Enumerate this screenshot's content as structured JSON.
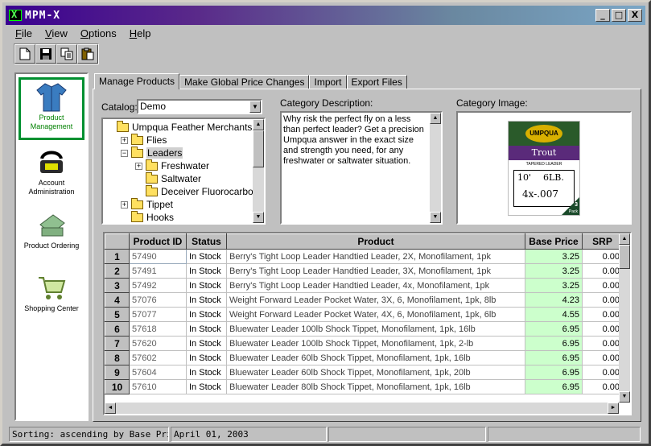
{
  "window": {
    "title": "MPM-X",
    "min_label": "_",
    "max_label": "□",
    "close_label": "X"
  },
  "menu": [
    "File",
    "View",
    "Options",
    "Help"
  ],
  "toolbar": {
    "buttons": [
      "new-icon",
      "save-icon",
      "copy-icon",
      "paste-icon"
    ]
  },
  "sidebar": {
    "items": [
      {
        "label": "Product Management",
        "icon": "jacket-icon"
      },
      {
        "label": "Account Administration",
        "icon": "phone-icon"
      },
      {
        "label": "Product Ordering",
        "icon": "register-icon"
      },
      {
        "label": "Shopping Center",
        "icon": "cart-icon"
      }
    ]
  },
  "tabs": [
    "Manage Products",
    "Make Global Price Changes",
    "Import",
    "Export Files"
  ],
  "catalog": {
    "label": "Catalog:",
    "value": "Demo"
  },
  "tree": {
    "items": [
      {
        "label": "Umpqua Feather Merchants",
        "level": 0,
        "expander": ""
      },
      {
        "label": "Flies",
        "level": 1,
        "expander": "+"
      },
      {
        "label": "Leaders",
        "level": 1,
        "expander": "−"
      },
      {
        "label": "Freshwater",
        "level": 2,
        "expander": "+"
      },
      {
        "label": "Saltwater",
        "level": 2,
        "expander": ""
      },
      {
        "label": "Deceiver Fluorocarbon",
        "level": 2,
        "expander": ""
      },
      {
        "label": "Tippet",
        "level": 1,
        "expander": "+"
      },
      {
        "label": "Hooks",
        "level": 1,
        "expander": ""
      }
    ]
  },
  "category_description": {
    "label": "Category Description:",
    "text": "Why risk the perfect fly on a less than perfect leader? Get a precision Umpqua answer in the exact size and strength you need, for any freshwater or saltwater situation."
  },
  "category_image": {
    "label": "Category Image:",
    "brand": "UMPQUA",
    "name": "Trout",
    "sub": "TAPERED LEADER",
    "length": "10'",
    "weight": "6LB.",
    "size": "4x-.007",
    "pack_number": "3",
    "pack_word": "Pack"
  },
  "grid": {
    "columns": [
      "Product ID",
      "Status",
      "Product",
      "Base Price",
      "SRP"
    ],
    "rows": [
      {
        "n": "1",
        "id": "57490",
        "status": "In Stock",
        "product": "Berry's Tight Loop Leader Handtied Leader, 2X, Monofilament, 1pk",
        "price": "3.25",
        "srp": "0.00"
      },
      {
        "n": "2",
        "id": "57491",
        "status": "In Stock",
        "product": "Berry's Tight Loop Leader Handtied Leader, 3X, Monofilament, 1pk",
        "price": "3.25",
        "srp": "0.00"
      },
      {
        "n": "3",
        "id": "57492",
        "status": "In Stock",
        "product": "Berry's Tight Loop Leader Handtied Leader, 4x, Monofilament, 1pk",
        "price": "3.25",
        "srp": "0.00"
      },
      {
        "n": "4",
        "id": "57076",
        "status": "In Stock",
        "product": "Weight Forward Leader Pocket Water, 3X, 6, Monofilament, 1pk, 8lb",
        "price": "4.23",
        "srp": "0.00"
      },
      {
        "n": "5",
        "id": "57077",
        "status": "In Stock",
        "product": "Weight Forward Leader Pocket Water, 4X, 6, Monofilament, 1pk, 6lb",
        "price": "4.55",
        "srp": "0.00"
      },
      {
        "n": "6",
        "id": "57618",
        "status": "In Stock",
        "product": "Bluewater Leader 100lb Shock Tippet, Monofilament, 1pk, 16lb",
        "price": "6.95",
        "srp": "0.00"
      },
      {
        "n": "7",
        "id": "57620",
        "status": "In Stock",
        "product": "Bluewater Leader 100lb Shock Tippet, Monofilament, 1pk, 2-lb",
        "price": "6.95",
        "srp": "0.00"
      },
      {
        "n": "8",
        "id": "57602",
        "status": "In Stock",
        "product": "Bluewater Leader 60lb Shock Tippet, Monofilament, 1pk, 16lb",
        "price": "6.95",
        "srp": "0.00"
      },
      {
        "n": "9",
        "id": "57604",
        "status": "In Stock",
        "product": "Bluewater Leader 60lb Shock Tippet, Monofilament, 1pk, 20lb",
        "price": "6.95",
        "srp": "0.00"
      },
      {
        "n": "10",
        "id": "57610",
        "status": "In Stock",
        "product": "Bluewater Leader 80lb Shock Tippet, Monofilament, 1pk, 16lb",
        "price": "6.95",
        "srp": "0.00"
      }
    ]
  },
  "status": {
    "sorting": "Sorting: ascending by Base Price.",
    "date": "April 01, 2003"
  },
  "colors": {
    "price_bg": "#ccffcc",
    "active_border": "#009030",
    "title_start": "#3a0090",
    "title_end": "#7aa6c6"
  }
}
